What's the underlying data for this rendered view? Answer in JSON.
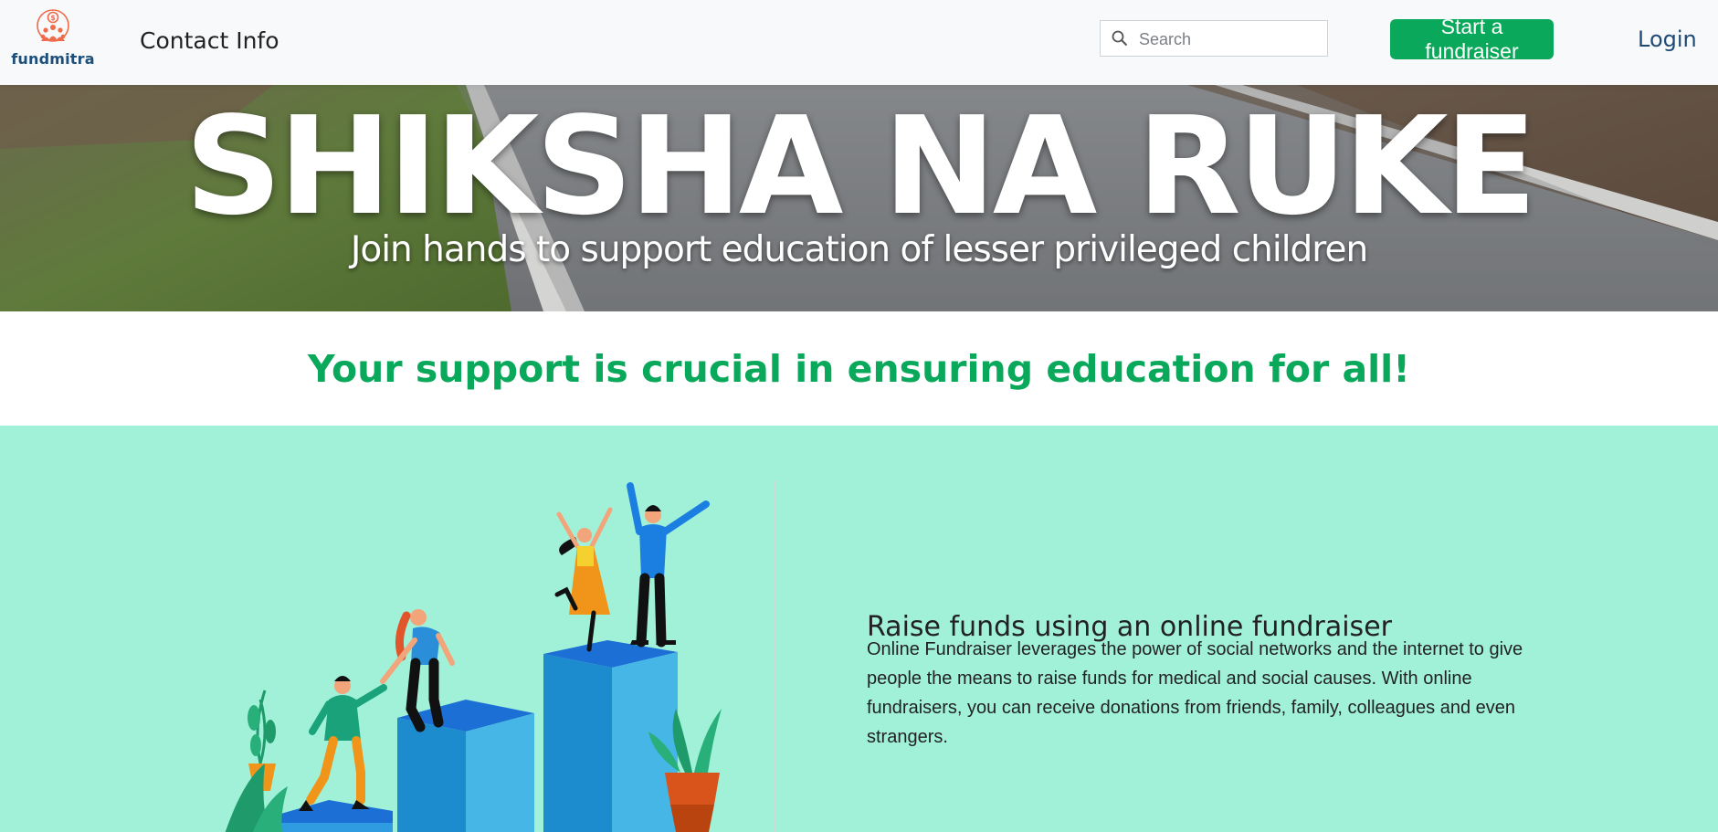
{
  "header": {
    "logo_text": "fundmitra",
    "nav_contact": "Contact Info",
    "search_placeholder": "Search",
    "start_button": "Start a fundraiser",
    "login": "Login"
  },
  "banner": {
    "title": "SHIKSHA NA RUKE",
    "subtitle": "Join hands to support education of lesser privileged children"
  },
  "tagline": "Your support is crucial in ensuring education for all!",
  "feature": {
    "heading": "Raise funds using an online fundraiser",
    "text": "Online Fundraiser leverages the power of social networks and the internet to give people the means to raise funds for medical and social causes. With online fundraisers, you can receive donations from friends, family, colleagues and even strangers."
  },
  "colors": {
    "brand_green": "#0aa85b",
    "feature_bg": "#a1f1d9",
    "login_blue": "#1e4a73",
    "logo_orange": "#ef6b4a"
  },
  "icons": [
    "fundmitra-logo-icon",
    "search-icon"
  ]
}
